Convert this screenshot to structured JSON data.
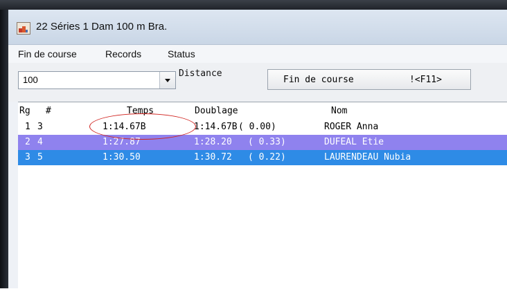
{
  "window": {
    "title": "22 Séries 1  Dam 100 m Bra."
  },
  "menu": [
    "Fin de course",
    "Records",
    "Status"
  ],
  "toolbar": {
    "distance_value": "100",
    "distance_label": "Distance",
    "finish_button_label": "Fin de course",
    "finish_button_shortcut": "!<F11>"
  },
  "results": {
    "headers": [
      "Rg",
      "#",
      "Temps",
      "Doublage",
      "Nom"
    ],
    "rows": [
      {
        "rank": "1",
        "num": "3",
        "time": "1:14.67B",
        "split": "1:14.67B",
        "diff": "( 0.00)",
        "name": "ROGER Anna"
      },
      {
        "rank": "2",
        "num": "4",
        "time": "1:27.87",
        "split": "1:28.20",
        "diff": "( 0.33)",
        "name": "DUFEAL Etie"
      },
      {
        "rank": "3",
        "num": "5",
        "time": "1:30.50",
        "split": "1:30.72",
        "diff": "( 0.22)",
        "name": "LAURENDEAU Nubia"
      }
    ],
    "row_colors": [
      "#ffffff",
      "#8f82ee",
      "#2e8be6"
    ],
    "annotation_color": "#d0211d"
  }
}
